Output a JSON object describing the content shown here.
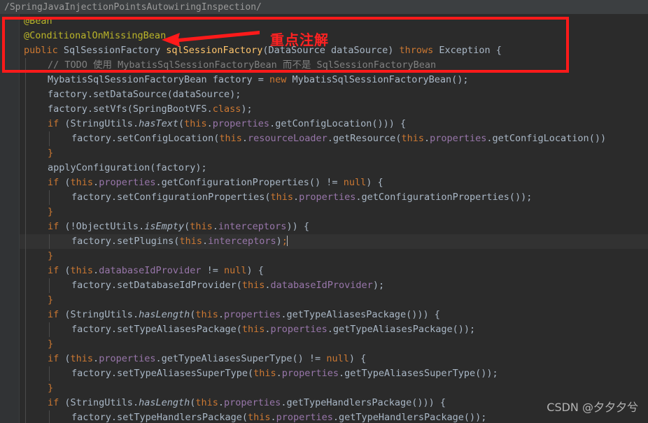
{
  "editor": {
    "theme": "darcula",
    "background": "#2B2B2B",
    "gutter_background": "#313335",
    "current_line_background": "#323232",
    "default_text_color": "#A9B7C6"
  },
  "breadcrumb": {
    "text": "/SpringJavaInjectionPointsAutowiringInspection/"
  },
  "annotation_overlay": {
    "box_color": "#FF1A1A",
    "note_text": "重点注解",
    "note_color": "#FF2222",
    "arrow_color": "#FF1A1A",
    "arrow_name": "left-pointing-arrow"
  },
  "watermark": {
    "text": "CSDN @夕夕夕兮"
  },
  "colors": {
    "keyword": "#CC7832",
    "annotation": "#BBB529",
    "field": "#9876AA",
    "method_declaration": "#FFC66D",
    "comment": "#808080",
    "identifier": "#A9B7C6",
    "number": "#6897BB"
  },
  "code": {
    "language": "java",
    "current_line_index": 12,
    "caret_line_index": 12,
    "lines": [
      {
        "indent": 0,
        "tokens": [
          {
            "t": "@Bean",
            "c": "annot"
          }
        ]
      },
      {
        "indent": 0,
        "tokens": [
          {
            "t": "@ConditionalOnMissingBean",
            "c": "annot"
          }
        ]
      },
      {
        "indent": 0,
        "tokens": [
          {
            "t": "public",
            "c": "kw"
          },
          {
            "t": " ",
            "c": "plain"
          },
          {
            "t": "SqlSessionFactory",
            "c": "type"
          },
          {
            "t": " ",
            "c": "plain"
          },
          {
            "t": "sqlSessionFactory",
            "c": "method"
          },
          {
            "t": "(",
            "c": "plain"
          },
          {
            "t": "DataSource",
            "c": "type"
          },
          {
            "t": " dataSource) ",
            "c": "plain"
          },
          {
            "t": "throws",
            "c": "kw"
          },
          {
            "t": " ",
            "c": "plain"
          },
          {
            "t": "Exception",
            "c": "type"
          },
          {
            "t": " {",
            "c": "plain"
          }
        ]
      },
      {
        "indent": 1,
        "tokens": [
          {
            "t": "// TODO 使用 MybatisSqlSessionFactoryBean 而不是 SqlSessionFactoryBean",
            "c": "cmt"
          }
        ]
      },
      {
        "indent": 1,
        "tokens": [
          {
            "t": "MybatisSqlSessionFactoryBean",
            "c": "type"
          },
          {
            "t": " factory = ",
            "c": "plain"
          },
          {
            "t": "new",
            "c": "kw"
          },
          {
            "t": " ",
            "c": "plain"
          },
          {
            "t": "MybatisSqlSessionFactoryBean",
            "c": "type"
          },
          {
            "t": "();",
            "c": "plain"
          }
        ]
      },
      {
        "indent": 1,
        "tokens": [
          {
            "t": "factory.setDataSource(dataSource);",
            "c": "plain"
          }
        ]
      },
      {
        "indent": 1,
        "tokens": [
          {
            "t": "factory.setVfs(",
            "c": "plain"
          },
          {
            "t": "SpringBootVFS",
            "c": "type"
          },
          {
            "t": ".",
            "c": "plain"
          },
          {
            "t": "class",
            "c": "kw"
          },
          {
            "t": ");",
            "c": "plain"
          }
        ]
      },
      {
        "indent": 1,
        "tokens": [
          {
            "t": "if",
            "c": "kw"
          },
          {
            "t": " (",
            "c": "plain"
          },
          {
            "t": "StringUtils",
            "c": "type"
          },
          {
            "t": ".",
            "c": "plain"
          },
          {
            "t": "hasText",
            "c": "stat"
          },
          {
            "t": "(",
            "c": "plain"
          },
          {
            "t": "this",
            "c": "kw"
          },
          {
            "t": ".",
            "c": "plain"
          },
          {
            "t": "properties",
            "c": "field"
          },
          {
            "t": ".getConfigLocation())) {",
            "c": "plain"
          }
        ]
      },
      {
        "indent": 2,
        "tokens": [
          {
            "t": "factory.setConfigLocation(",
            "c": "plain"
          },
          {
            "t": "this",
            "c": "kw"
          },
          {
            "t": ".",
            "c": "plain"
          },
          {
            "t": "resourceLoader",
            "c": "field"
          },
          {
            "t": ".getResource(",
            "c": "plain"
          },
          {
            "t": "this",
            "c": "kw"
          },
          {
            "t": ".",
            "c": "plain"
          },
          {
            "t": "properties",
            "c": "field"
          },
          {
            "t": ".getConfigLocation())",
            "c": "plain"
          }
        ]
      },
      {
        "indent": 1,
        "tokens": [
          {
            "t": "}",
            "c": "kw"
          }
        ]
      },
      {
        "indent": 1,
        "tokens": [
          {
            "t": "applyConfiguration(factory);",
            "c": "plain"
          }
        ]
      },
      {
        "indent": 1,
        "tokens": [
          {
            "t": "if",
            "c": "kw"
          },
          {
            "t": " (",
            "c": "plain"
          },
          {
            "t": "this",
            "c": "kw"
          },
          {
            "t": ".",
            "c": "plain"
          },
          {
            "t": "properties",
            "c": "field"
          },
          {
            "t": ".getConfigurationProperties() != ",
            "c": "plain"
          },
          {
            "t": "null",
            "c": "kw"
          },
          {
            "t": ") {",
            "c": "plain"
          }
        ]
      },
      {
        "indent": 2,
        "tokens": [
          {
            "t": "factory.setConfigurationProperties(",
            "c": "plain"
          },
          {
            "t": "this",
            "c": "kw"
          },
          {
            "t": ".",
            "c": "plain"
          },
          {
            "t": "properties",
            "c": "field"
          },
          {
            "t": ".getConfigurationProperties());",
            "c": "plain"
          }
        ]
      },
      {
        "indent": 1,
        "tokens": [
          {
            "t": "}",
            "c": "kw"
          }
        ]
      },
      {
        "indent": 1,
        "tokens": [
          {
            "t": "if",
            "c": "kw"
          },
          {
            "t": " (!",
            "c": "plain"
          },
          {
            "t": "ObjectUtils",
            "c": "type"
          },
          {
            "t": ".",
            "c": "plain"
          },
          {
            "t": "isEmpty",
            "c": "stat"
          },
          {
            "t": "(",
            "c": "plain"
          },
          {
            "t": "this",
            "c": "kw"
          },
          {
            "t": ".",
            "c": "plain"
          },
          {
            "t": "interceptors",
            "c": "field"
          },
          {
            "t": ")) {",
            "c": "plain"
          }
        ]
      },
      {
        "indent": 2,
        "current": true,
        "caret": true,
        "tokens": [
          {
            "t": "factory.setPlugins(",
            "c": "plain"
          },
          {
            "t": "this",
            "c": "kw"
          },
          {
            "t": ".",
            "c": "plain"
          },
          {
            "t": "interceptors",
            "c": "field"
          },
          {
            "t": ")",
            "c": "plain"
          },
          {
            "t": ";",
            "c": "kw"
          }
        ]
      },
      {
        "indent": 1,
        "tokens": [
          {
            "t": "}",
            "c": "kw"
          }
        ]
      },
      {
        "indent": 1,
        "tokens": [
          {
            "t": "if",
            "c": "kw"
          },
          {
            "t": " (",
            "c": "plain"
          },
          {
            "t": "this",
            "c": "kw"
          },
          {
            "t": ".",
            "c": "plain"
          },
          {
            "t": "databaseIdProvider",
            "c": "field"
          },
          {
            "t": " != ",
            "c": "plain"
          },
          {
            "t": "null",
            "c": "kw"
          },
          {
            "t": ") {",
            "c": "plain"
          }
        ]
      },
      {
        "indent": 2,
        "tokens": [
          {
            "t": "factory.setDatabaseIdProvider(",
            "c": "plain"
          },
          {
            "t": "this",
            "c": "kw"
          },
          {
            "t": ".",
            "c": "plain"
          },
          {
            "t": "databaseIdProvider",
            "c": "field"
          },
          {
            "t": ");",
            "c": "plain"
          }
        ]
      },
      {
        "indent": 1,
        "tokens": [
          {
            "t": "}",
            "c": "kw"
          }
        ]
      },
      {
        "indent": 1,
        "tokens": [
          {
            "t": "if",
            "c": "kw"
          },
          {
            "t": " (",
            "c": "plain"
          },
          {
            "t": "StringUtils",
            "c": "type"
          },
          {
            "t": ".",
            "c": "plain"
          },
          {
            "t": "hasLength",
            "c": "stat"
          },
          {
            "t": "(",
            "c": "plain"
          },
          {
            "t": "this",
            "c": "kw"
          },
          {
            "t": ".",
            "c": "plain"
          },
          {
            "t": "properties",
            "c": "field"
          },
          {
            "t": ".getTypeAliasesPackage())) {",
            "c": "plain"
          }
        ]
      },
      {
        "indent": 2,
        "tokens": [
          {
            "t": "factory.setTypeAliasesPackage(",
            "c": "plain"
          },
          {
            "t": "this",
            "c": "kw"
          },
          {
            "t": ".",
            "c": "plain"
          },
          {
            "t": "properties",
            "c": "field"
          },
          {
            "t": ".getTypeAliasesPackage());",
            "c": "plain"
          }
        ]
      },
      {
        "indent": 1,
        "tokens": [
          {
            "t": "}",
            "c": "kw"
          }
        ]
      },
      {
        "indent": 1,
        "tokens": [
          {
            "t": "if",
            "c": "kw"
          },
          {
            "t": " (",
            "c": "plain"
          },
          {
            "t": "this",
            "c": "kw"
          },
          {
            "t": ".",
            "c": "plain"
          },
          {
            "t": "properties",
            "c": "field"
          },
          {
            "t": ".getTypeAliasesSuperType() != ",
            "c": "plain"
          },
          {
            "t": "null",
            "c": "kw"
          },
          {
            "t": ") {",
            "c": "plain"
          }
        ]
      },
      {
        "indent": 2,
        "tokens": [
          {
            "t": "factory.setTypeAliasesSuperType(",
            "c": "plain"
          },
          {
            "t": "this",
            "c": "kw"
          },
          {
            "t": ".",
            "c": "plain"
          },
          {
            "t": "properties",
            "c": "field"
          },
          {
            "t": ".getTypeAliasesSuperType());",
            "c": "plain"
          }
        ]
      },
      {
        "indent": 1,
        "tokens": [
          {
            "t": "}",
            "c": "kw"
          }
        ]
      },
      {
        "indent": 1,
        "tokens": [
          {
            "t": "if",
            "c": "kw"
          },
          {
            "t": " (",
            "c": "plain"
          },
          {
            "t": "StringUtils",
            "c": "type"
          },
          {
            "t": ".",
            "c": "plain"
          },
          {
            "t": "hasLength",
            "c": "stat"
          },
          {
            "t": "(",
            "c": "plain"
          },
          {
            "t": "this",
            "c": "kw"
          },
          {
            "t": ".",
            "c": "plain"
          },
          {
            "t": "properties",
            "c": "field"
          },
          {
            "t": ".getTypeHandlersPackage())) {",
            "c": "plain"
          }
        ]
      },
      {
        "indent": 2,
        "tokens": [
          {
            "t": "factory.setTypeHandlersPackage(",
            "c": "plain"
          },
          {
            "t": "this",
            "c": "kw"
          },
          {
            "t": ".",
            "c": "plain"
          },
          {
            "t": "properties",
            "c": "field"
          },
          {
            "t": ".getTypeHandlersPackage());",
            "c": "plain"
          }
        ]
      }
    ]
  }
}
